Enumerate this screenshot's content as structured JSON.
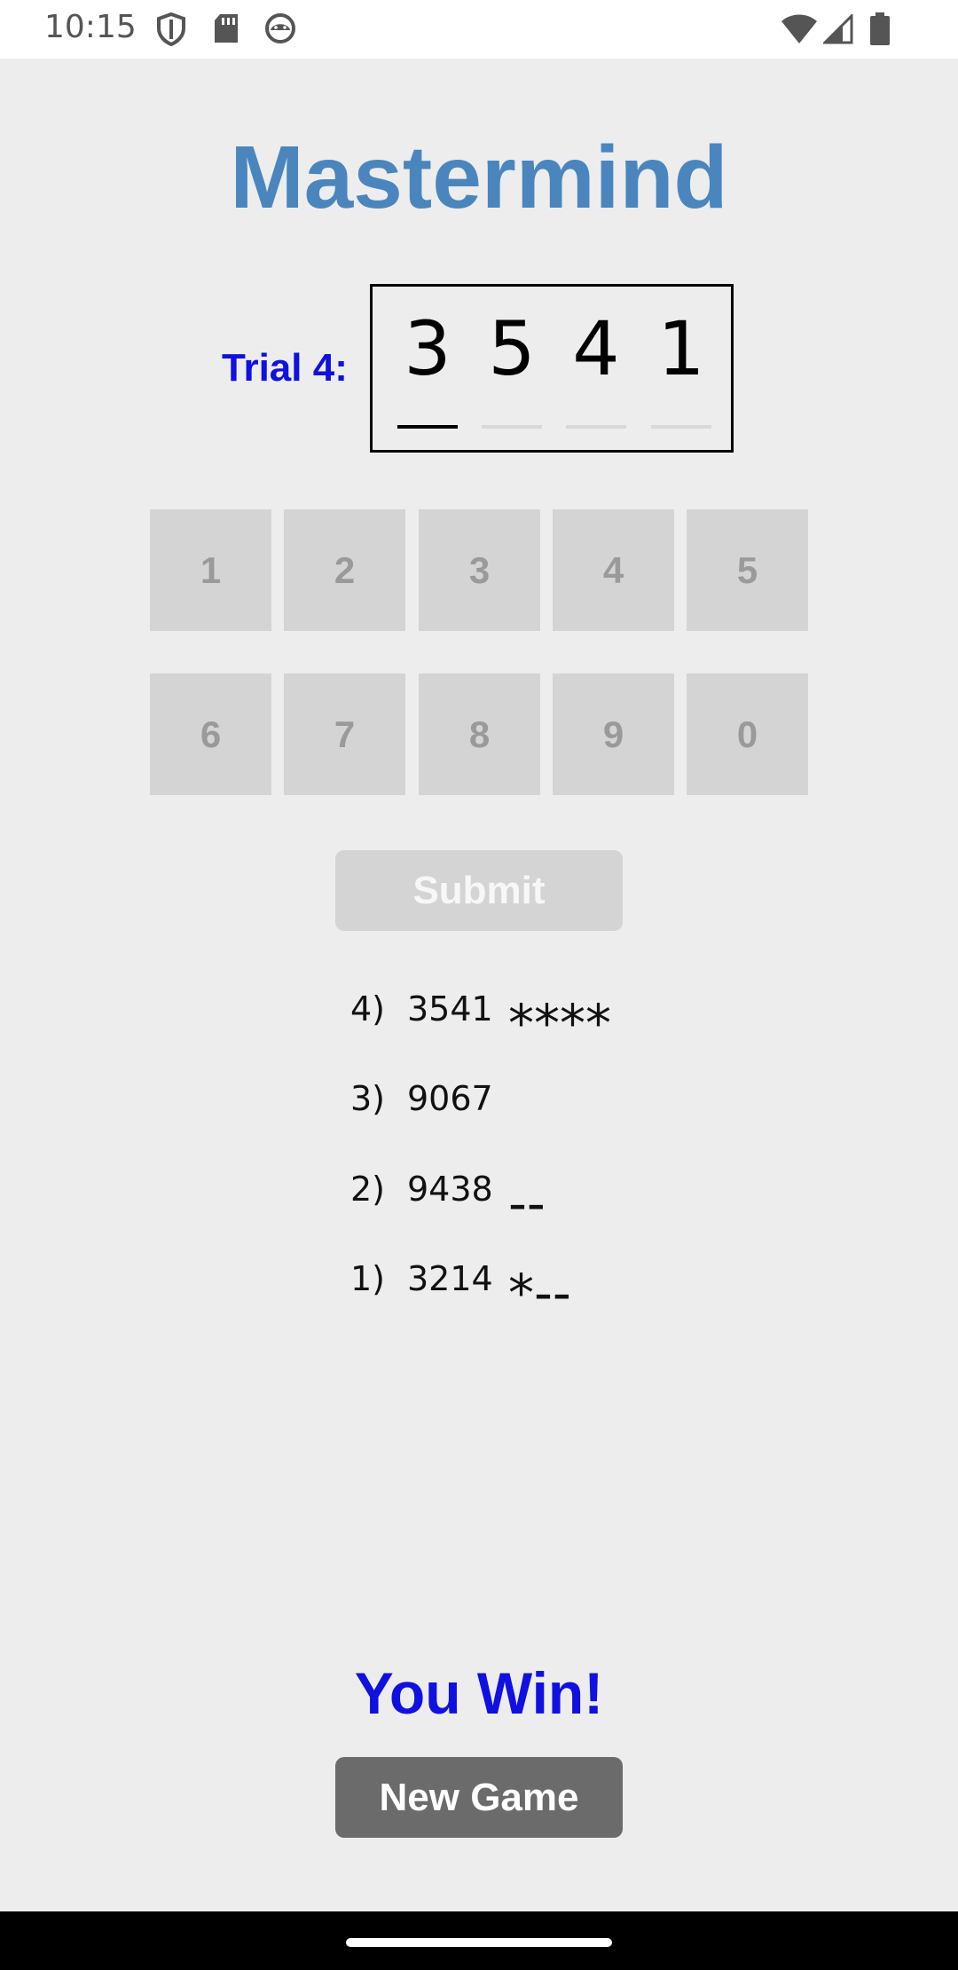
{
  "status_bar": {
    "time": "10:15",
    "icons_left": [
      "shield-icon",
      "sd-card-icon",
      "android-icon"
    ],
    "icons_right": [
      "wifi-icon",
      "signal-icon",
      "battery-icon"
    ]
  },
  "app": {
    "title": "Mastermind",
    "accent_color": "#4a86bd",
    "label_color": "#1010e0"
  },
  "trial": {
    "label": "Trial 4:",
    "digits": [
      "3",
      "5",
      "4",
      "1"
    ],
    "active_index": 0
  },
  "keypad": {
    "row1": [
      "1",
      "2",
      "3",
      "4",
      "5"
    ],
    "row2": [
      "6",
      "7",
      "8",
      "9",
      "0"
    ]
  },
  "submit": {
    "label": "Submit"
  },
  "history": [
    {
      "num": "4)",
      "guess": "3541",
      "result": "****"
    },
    {
      "num": "3)",
      "guess": "9067",
      "result": ""
    },
    {
      "num": "2)",
      "guess": "9438",
      "result": "--"
    },
    {
      "num": "1)",
      "guess": "3214",
      "result": "*--"
    }
  ],
  "result_message": "You Win!",
  "new_game": {
    "label": "New Game"
  }
}
